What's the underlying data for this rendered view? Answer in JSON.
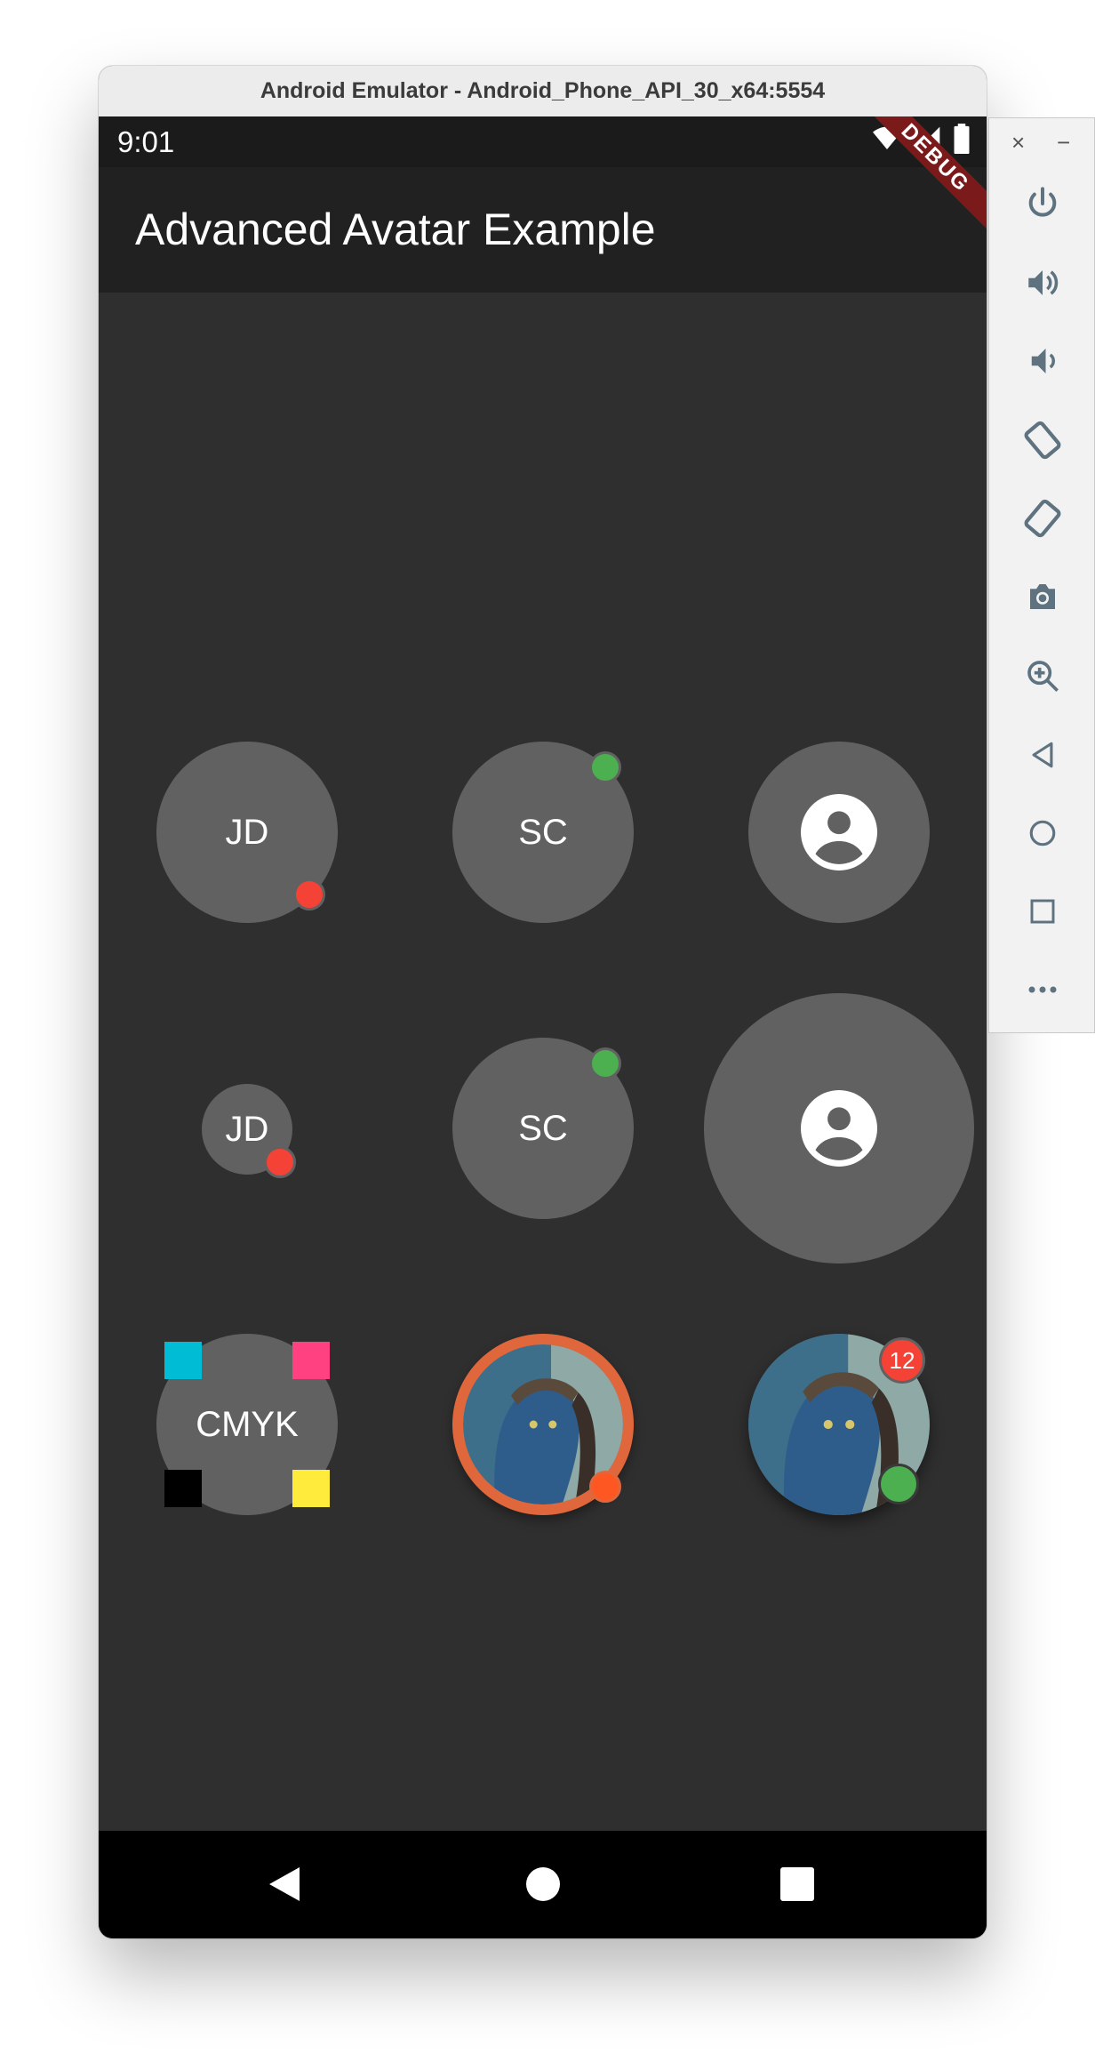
{
  "window": {
    "title": "Android Emulator - Android_Phone_API_30_x64:5554"
  },
  "status_bar": {
    "time": "9:01"
  },
  "debug_banner": "DEBUG",
  "app_bar": {
    "title": "Advanced Avatar Example"
  },
  "avatars": {
    "row1": [
      {
        "initials": "JD",
        "status": "red"
      },
      {
        "initials": "SC",
        "status": "green"
      },
      {
        "icon": "account-circle-icon"
      }
    ],
    "row2": [
      {
        "initials": "JD",
        "status": "red"
      },
      {
        "initials": "SC",
        "status": "green"
      },
      {
        "icon": "account-circle-icon"
      }
    ],
    "row3": [
      {
        "initials": "CMYK",
        "corners": [
          "cyan",
          "magenta",
          "black",
          "yellow"
        ]
      },
      {
        "image": "avatar-photo",
        "ring": "orange",
        "status": "orange"
      },
      {
        "image": "avatar-photo",
        "badge_count": "12",
        "status": "green"
      }
    ]
  },
  "colors": {
    "avatar_bg": "#616161",
    "red": "#f44336",
    "green": "#4caf50",
    "orange": "#ff5722",
    "cyan": "#00bcd4",
    "magenta": "#ff4081",
    "black": "#000000",
    "yellow": "#ffeb3b"
  },
  "side_toolbar": {
    "close_label": "×",
    "minimize_label": "−",
    "buttons": [
      "power-icon",
      "volume-up-icon",
      "volume-down-icon",
      "rotate-left-icon",
      "rotate-right-icon",
      "camera-icon",
      "zoom-icon",
      "back-icon",
      "home-icon",
      "overview-icon",
      "more-icon"
    ]
  },
  "nav_bar": {
    "buttons": [
      "back-icon",
      "home-icon",
      "recents-icon"
    ]
  }
}
